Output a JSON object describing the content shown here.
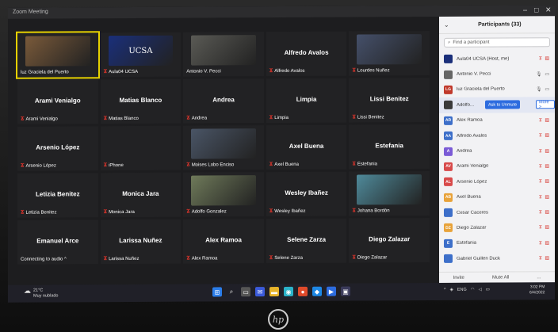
{
  "window": {
    "title": "Zoom Meeting"
  },
  "gallery": [
    {
      "name": "",
      "label": "luz Graciela del Puerto",
      "muted": false,
      "photo": "#7a5a3a",
      "active": true
    },
    {
      "name": "",
      "label": "Aula04 UCSA",
      "muted": true,
      "photo": "#1a2f7a",
      "logo": "UCSA"
    },
    {
      "name": "",
      "label": "Antonio V. Pecci",
      "muted": false,
      "photo": "#5a5a55"
    },
    {
      "name": "Alfredo Avalos",
      "label": "Alfredo Avalos",
      "muted": true
    },
    {
      "name": "",
      "label": "Lourdes Nuñez",
      "muted": true,
      "photo": "#45506a"
    },
    {
      "name": "Arami Venialgo",
      "label": "Arami Venialgo",
      "muted": true
    },
    {
      "name": "Matias Blanco",
      "label": "Matias Blanco",
      "muted": true
    },
    {
      "name": "Andrea",
      "label": "Andrea",
      "muted": true
    },
    {
      "name": "Limpia",
      "label": "Limpia",
      "muted": true
    },
    {
      "name": "Lissi Benitez",
      "label": "Lissi Benitez",
      "muted": true
    },
    {
      "name": "Arsenio López",
      "label": "Arsenio López",
      "muted": true
    },
    {
      "name": "",
      "label": "iPhone",
      "muted": true
    },
    {
      "name": "",
      "label": "Moises Lobo Enciso",
      "muted": true,
      "photo": "#4a5566"
    },
    {
      "name": "Axel Buena",
      "label": "Axel Buena",
      "muted": true
    },
    {
      "name": "Estefania",
      "label": "Estefania",
      "muted": true
    },
    {
      "name": "Letizia Benitez",
      "label": "Letizia Benitez",
      "muted": true
    },
    {
      "name": "Monica Jara",
      "label": "Monica Jara",
      "muted": true
    },
    {
      "name": "",
      "label": "Adolfo Gonzalez",
      "muted": true,
      "photo": "#6f7a5a"
    },
    {
      "name": "Wesley Ibañez",
      "label": "Wesley Ibañez",
      "muted": true
    },
    {
      "name": "",
      "label": "Johana Bordón",
      "muted": true,
      "photo": "#4f8a9a"
    },
    {
      "name": "Emanuel Arce",
      "label": "Connecting to audio ^",
      "muted": false
    },
    {
      "name": "Larissa Nuñez",
      "label": "Larissa Nuñez",
      "muted": true
    },
    {
      "name": "Alex Ramoa",
      "label": "Alex Ramoa",
      "muted": true
    },
    {
      "name": "Selene Zarza",
      "label": "Selene Zarza",
      "muted": true
    },
    {
      "name": "Diego Zalazar",
      "label": "Diego Zalazar",
      "muted": true
    }
  ],
  "sidebar": {
    "title": "Participants (33)",
    "search_placeholder": "Find a participant",
    "unmute_label": "Ask to Unmute",
    "more_label": "More >",
    "participants": [
      {
        "initials": "",
        "name": "Aula04 UCSA (Host, me)",
        "color": "#1a2f7a",
        "icons": "muted"
      },
      {
        "initials": "",
        "name": "Antonio V. Pecci",
        "color": "#666",
        "icons": "ok"
      },
      {
        "initials": "LG",
        "name": "luz Graciela del Puerto",
        "color": "#c0392b",
        "icons": "ok"
      },
      {
        "initials": "",
        "name": "Adolfo...",
        "color": "#3a3a3a",
        "icons": "muted",
        "hover": true
      },
      {
        "initials": "AR",
        "name": "Alex Ramoa",
        "color": "#3d6fc9",
        "icons": "muted"
      },
      {
        "initials": "AA",
        "name": "Alfredo Avalos",
        "color": "#3d6fc9",
        "icons": "muted"
      },
      {
        "initials": "A",
        "name": "Andrea",
        "color": "#7b5bd6",
        "icons": "muted"
      },
      {
        "initials": "AV",
        "name": "Arami Venialgo",
        "color": "#d84a4a",
        "icons": "muted"
      },
      {
        "initials": "AL",
        "name": "Arsenio López",
        "color": "#d84a4a",
        "icons": "muted"
      },
      {
        "initials": "AB",
        "name": "Axel Buena",
        "color": "#e8a33a",
        "icons": "muted"
      },
      {
        "initials": "",
        "name": "Cesar Caceres",
        "color": "#3d6fc9",
        "icons": "muted"
      },
      {
        "initials": "DZ",
        "name": "Diego Zalazar",
        "color": "#e8a33a",
        "icons": "muted"
      },
      {
        "initials": "E",
        "name": "Estefania",
        "color": "#3d6fc9",
        "icons": "muted"
      },
      {
        "initials": "",
        "name": "Gabriel Guillen Duck",
        "color": "#3d6fc9",
        "icons": "muted"
      }
    ],
    "footer": {
      "invite": "Invite",
      "mute_all": "Mute All",
      "more": "..."
    }
  },
  "taskbar": {
    "temp": "21°C",
    "weather": "Muy nublado",
    "lang": "ENG",
    "time": "3:02 PM",
    "date": "6/4/2022"
  },
  "brand": "hp"
}
